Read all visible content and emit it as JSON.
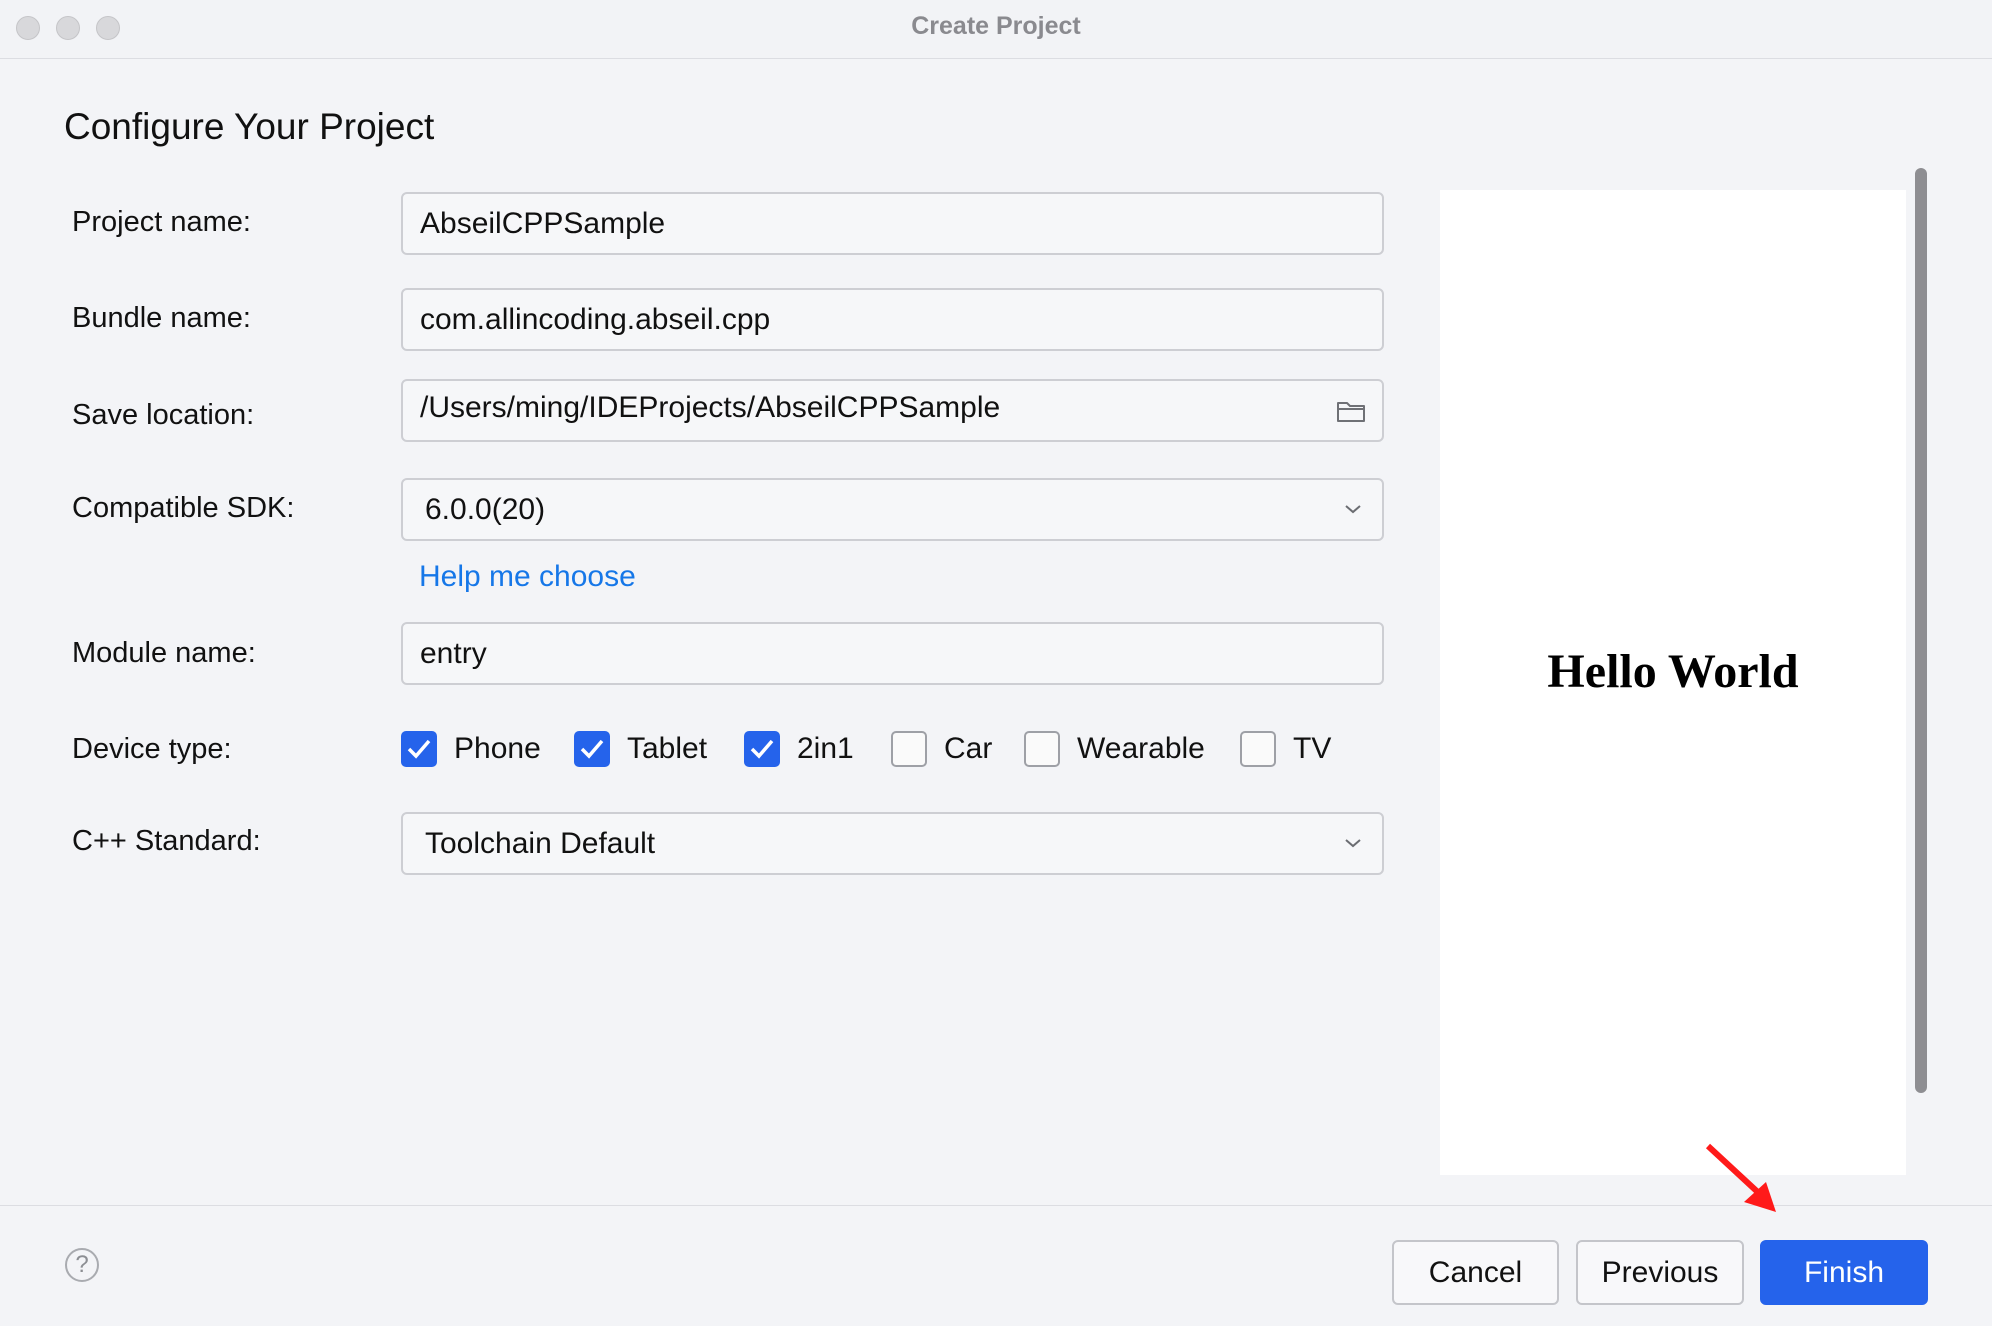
{
  "window": {
    "title": "Create Project"
  },
  "page": {
    "title": "Configure Your Project"
  },
  "form": {
    "project_name": {
      "label": "Project name:",
      "value": "AbseilCPPSample"
    },
    "bundle_name": {
      "label": "Bundle name:",
      "value": "com.allincoding.abseil.cpp"
    },
    "save_location": {
      "label": "Save location:",
      "value": "/Users/ming/IDEProjects/AbseilCPPSample",
      "icon": "folder-icon"
    },
    "compatible_sdk": {
      "label": "Compatible SDK:",
      "value": "6.0.0(20)",
      "help_link": "Help me choose"
    },
    "module_name": {
      "label": "Module name:",
      "value": "entry"
    },
    "device_type": {
      "label": "Device type:",
      "options": [
        {
          "label": "Phone",
          "checked": true
        },
        {
          "label": "Tablet",
          "checked": true
        },
        {
          "label": "2in1",
          "checked": true
        },
        {
          "label": "Car",
          "checked": false
        },
        {
          "label": "Wearable",
          "checked": false
        },
        {
          "label": "TV",
          "checked": false
        }
      ]
    },
    "cpp_standard": {
      "label": "C++ Standard:",
      "value": "Toolchain Default"
    }
  },
  "preview": {
    "text": "Hello World"
  },
  "footer": {
    "help_icon": "question-icon",
    "help_text": "?",
    "cancel": "Cancel",
    "previous": "Previous",
    "finish": "Finish"
  },
  "colors": {
    "accent": "#2563eb",
    "link": "#1677e8",
    "annotation_arrow": "#ff0000"
  }
}
